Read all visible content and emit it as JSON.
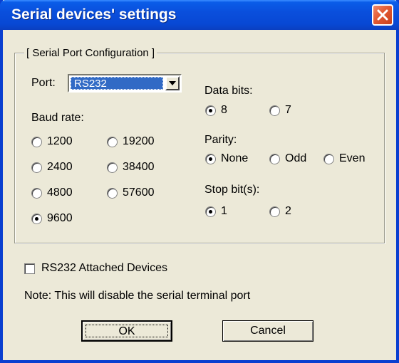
{
  "window": {
    "title": "Serial devices' settings"
  },
  "group": {
    "title": "[ Serial Port Configuration ]"
  },
  "port": {
    "label": "Port:",
    "selected": "RS232"
  },
  "baud": {
    "label": "Baud rate:",
    "options": [
      "1200",
      "19200",
      "2400",
      "38400",
      "4800",
      "57600",
      "9600"
    ],
    "selected": "9600"
  },
  "data_bits": {
    "label": "Data bits:",
    "options": [
      "8",
      "7"
    ],
    "selected": "8"
  },
  "parity": {
    "label": "Parity:",
    "options": [
      "None",
      "Odd",
      "Even"
    ],
    "selected": "None"
  },
  "stop_bits": {
    "label": "Stop bit(s):",
    "options": [
      "1",
      "2"
    ],
    "selected": "1"
  },
  "attached": {
    "label": "RS232 Attached Devices",
    "checked": false
  },
  "note": "Note: This will disable the serial terminal port",
  "buttons": {
    "ok": "OK",
    "cancel": "Cancel"
  }
}
